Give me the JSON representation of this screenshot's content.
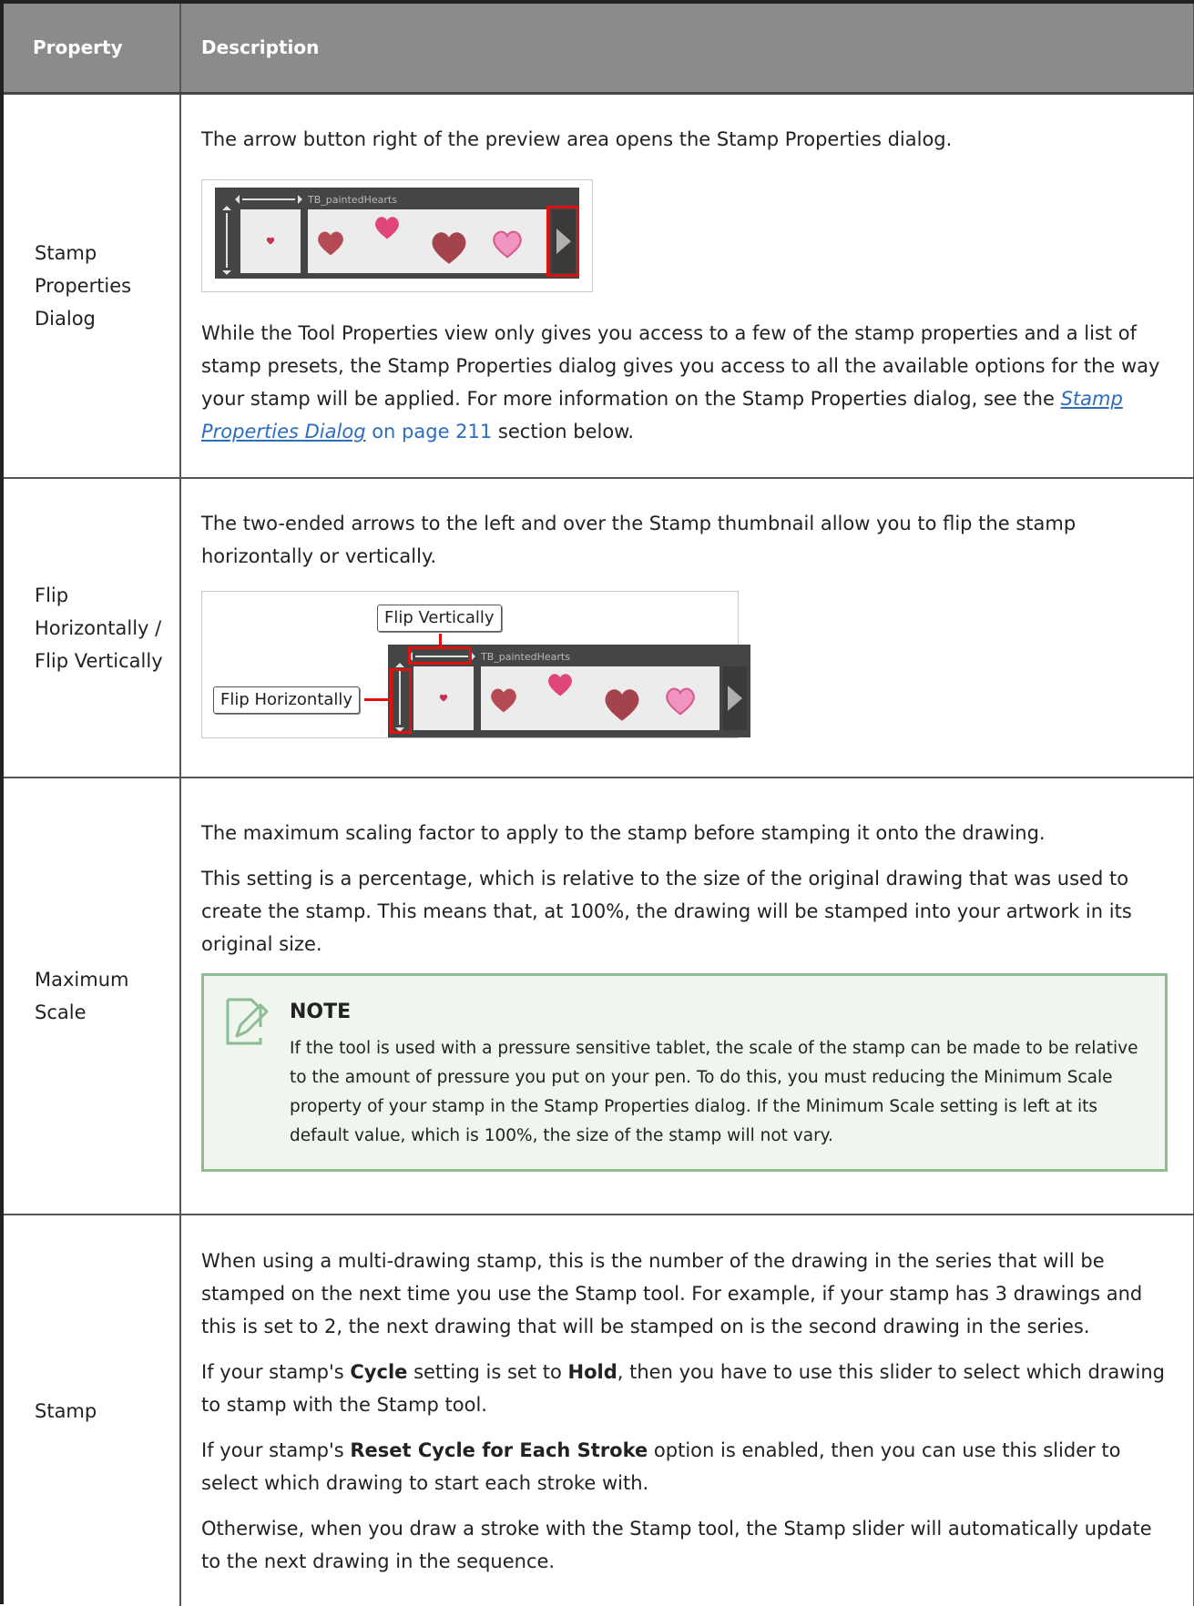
{
  "header": {
    "col1": "Property",
    "col2": "Description"
  },
  "rows": {
    "r1": {
      "property": "Stamp Properties Dialog",
      "p1": "The arrow button right of the preview area opens the Stamp Properties dialog.",
      "p2_before": "While the Tool Properties view only gives you access to a few of the stamp properties and a list of stamp presets, the Stamp Properties dialog gives you access to all the available options for the way your stamp will be applied. For more information on the Stamp Properties dialog, see the ",
      "link": "Stamp Properties Dialog",
      "page_ref": " on page 211",
      "p2_after": " section below.",
      "stamp_name": "TB_paintedHearts"
    },
    "r2": {
      "property": "Flip Horizontally / Flip Vertically",
      "p1": "The two-ended arrows to the left and over the Stamp thumbnail allow you to flip the stamp horizontally or vertically.",
      "callout_vertical": "Flip Vertically",
      "callout_horizontal": "Flip Horizontally",
      "stamp_name": "TB_paintedHearts"
    },
    "r3": {
      "property": "Maximum Scale",
      "p1": "The maximum scaling factor to apply to the stamp before stamping it onto the drawing.",
      "p2": "This setting is a percentage, which is relative to the size of the original drawing that was used to create the stamp. This means that, at 100%, the drawing will be stamped into your artwork in its original size.",
      "note_title": "NOTE",
      "note_body": "If the tool is used with a pressure sensitive tablet, the scale of the stamp can be made to be relative to the amount of pressure you put on your pen. To do this, you must reducing the Minimum Scale property of your stamp in the Stamp Properties dialog. If the Minimum Scale setting is left at its default value, which is 100%, the size of the stamp will not vary."
    },
    "r4": {
      "property": "Stamp",
      "p1": "When using a multi-drawing stamp, this is the number of the drawing in the series that will be stamped on the next time you use the Stamp tool. For example, if your stamp has 3 drawings and this is set to 2, the next drawing that will be stamped on is the second drawing in the series.",
      "p2_before": "If your stamp's ",
      "p2_bold1": "Cycle",
      "p2_mid": " setting is set to ",
      "p2_bold2": "Hold",
      "p2_after": ", then you have to use this slider to select which drawing to stamp with the Stamp tool.",
      "p3_before": "If your stamp's ",
      "p3_bold": "Reset Cycle for Each Stroke",
      "p3_after": " option is enabled, then you can use this slider to select which drawing to start each stroke with.",
      "p4": "Otherwise, when you draw a stroke with the Stamp tool, the Stamp slider will automatically update to the next drawing in the sequence."
    }
  },
  "colors": {
    "header_bg": "#8a8b8d",
    "link": "#2c6dbd",
    "highlight_red": "#e01010",
    "note_border": "#8dbb92",
    "note_bg": "#eef6ee"
  }
}
